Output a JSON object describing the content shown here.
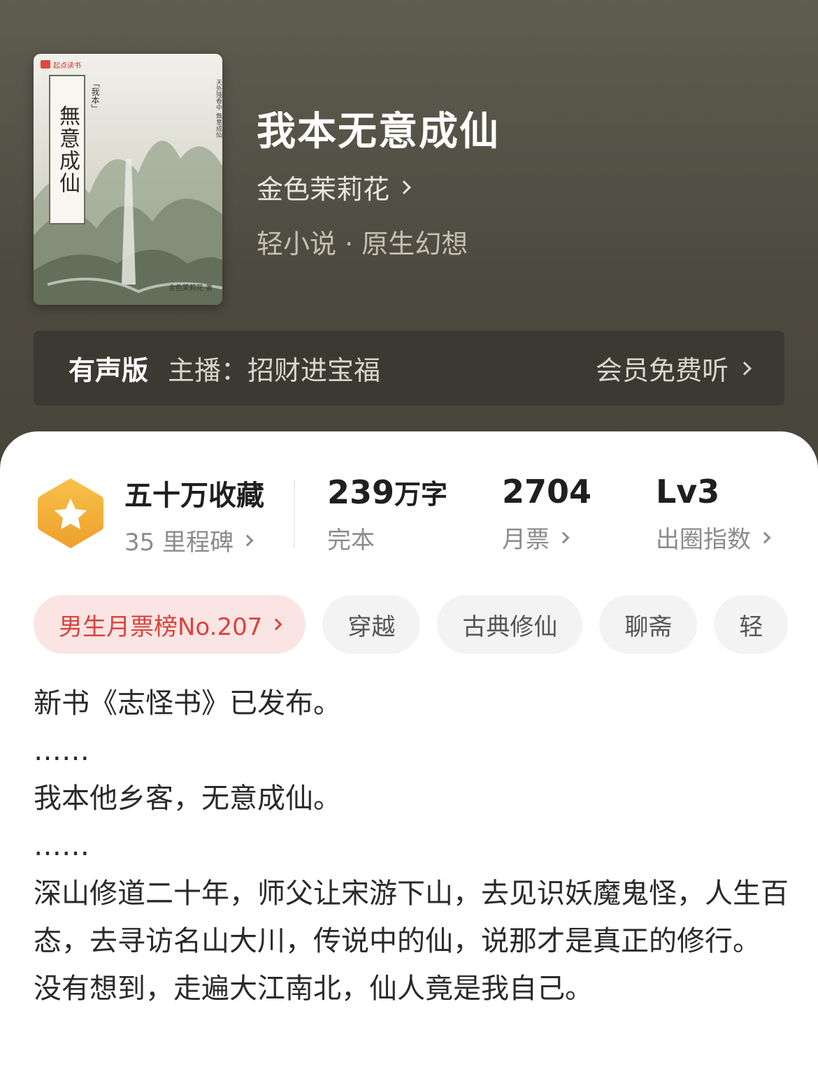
{
  "book": {
    "title": "我本无意成仙",
    "author": "金色茉莉花",
    "genre": "轻小说 · 原生幻想"
  },
  "cover": {
    "brand": "起点读书",
    "title": "無意成仙",
    "subtitle": "「我本」",
    "vertical_text": "天外殘卷中 無意成仙",
    "author": "金色茉莉花 著"
  },
  "audio": {
    "tag": "有声版",
    "host": "主播：招财进宝福",
    "cta": "会员免费听"
  },
  "stats": {
    "collect": {
      "value": "五十万收藏",
      "label": "35 里程碑"
    },
    "words": {
      "value": "239",
      "unit": "万字",
      "label": "完本"
    },
    "votes": {
      "value": "2704",
      "label": "月票"
    },
    "level": {
      "value": "Lv3",
      "label": "出圈指数"
    }
  },
  "tags": [
    "男生月票榜No.207",
    "穿越",
    "古典修仙",
    "聊斋",
    "轻"
  ],
  "description": [
    "新书《志怪书》已发布。",
    "……",
    "我本他乡客，无意成仙。",
    "……",
    "深山修道二十年，师父让宋游下山，去见识妖魔鬼怪，人生百态，去寻访名山大川，传说中的仙，说那才是真正的修行。",
    "没有想到，走遍大江南北，仙人竟是我自己。"
  ],
  "colors": {
    "header_top": "#5f5d50",
    "header_bottom": "#47443a",
    "audio_bar": "#3b3931",
    "rank_tag_bg": "#fbe5e4",
    "rank_tag_text": "#d9433d",
    "badge": "#f3b23a"
  },
  "icons": [
    "star-hexagon-icon",
    "chevron-right-icon"
  ]
}
